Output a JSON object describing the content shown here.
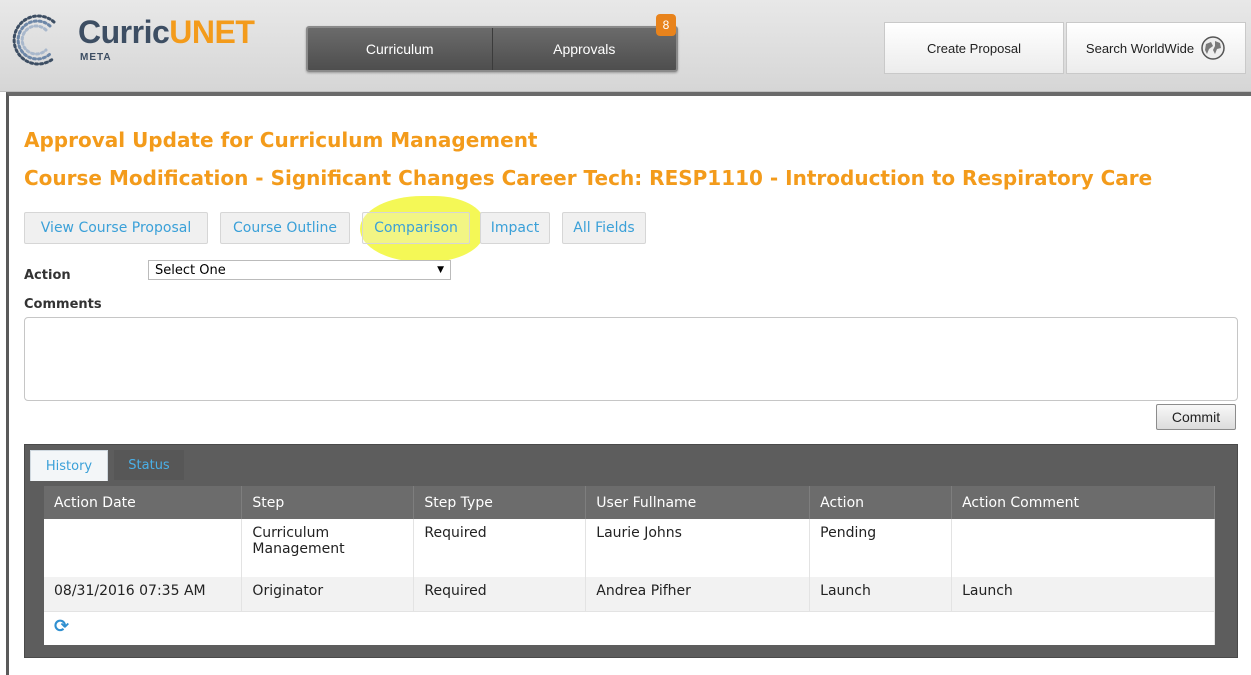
{
  "brand": {
    "name_part1": "Curric",
    "name_part2": "UNET",
    "sub": "META",
    "accent_color": "#f39b1b"
  },
  "topnav": {
    "items": [
      "Curriculum",
      "Approvals"
    ],
    "approvals_badge": "8"
  },
  "header_buttons": {
    "create": "Create Proposal",
    "search": "Search WorldWide",
    "search_icon": "globe-icon"
  },
  "page": {
    "title": "Approval Update for Curriculum Management",
    "subtitle": "Course Modification - Significant Changes Career Tech: RESP1110 - Introduction to Respiratory Care"
  },
  "view_tabs": [
    "View Course Proposal",
    "Course Outline",
    "Comparison",
    "Impact",
    "All Fields"
  ],
  "form": {
    "action_label": "Action",
    "action_value": "Select One",
    "comments_label": "Comments",
    "commit_label": "Commit"
  },
  "panel_tabs": [
    "History",
    "Status"
  ],
  "history": {
    "columns": [
      "Action Date",
      "Step",
      "Step Type",
      "User Fullname",
      "Action",
      "Action Comment"
    ],
    "rows": [
      [
        "",
        "Curriculum Management",
        "Required",
        "Laurie Johns",
        "Pending",
        ""
      ],
      [
        "08/31/2016 07:35 AM",
        "Originator",
        "Required",
        "Andrea Pifher",
        "Launch",
        "Launch"
      ]
    ],
    "refresh_icon": "refresh-icon"
  }
}
